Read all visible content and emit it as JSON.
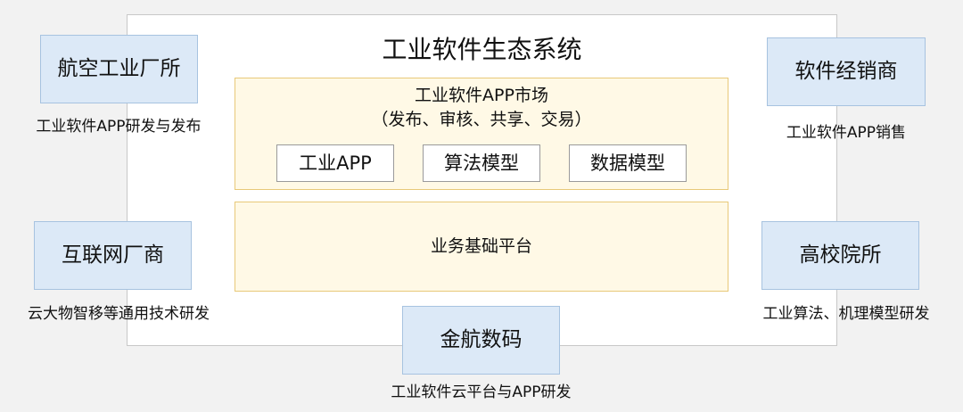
{
  "ecosystem": {
    "title": "工业软件生态系统",
    "market": {
      "title": "工业软件APP市场",
      "subtitle": "（发布、审核、共享、交易）",
      "items": [
        "工业APP",
        "算法模型",
        "数据模型"
      ]
    },
    "platform": "业务基础平台"
  },
  "parties": {
    "aviation": {
      "name": "航空工业厂所",
      "role": "工业软件APP研发与发布"
    },
    "internet": {
      "name": "互联网厂商",
      "role": "云大物智移等通用技术研发"
    },
    "dealer": {
      "name": "软件经销商",
      "role": "工业软件APP销售"
    },
    "university": {
      "name": "高校院所",
      "role": "工业算法、机理模型研发"
    },
    "jinhang": {
      "name": "金航数码",
      "role": "工业软件云平台与APP研发"
    }
  },
  "colors": {
    "party_fill": "#dce9f7",
    "party_border": "#a7c3e0",
    "layer_fill": "#fff9e6",
    "layer_border": "#e8c979"
  }
}
